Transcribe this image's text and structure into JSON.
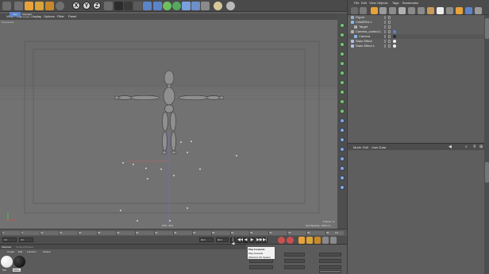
{
  "toolbar": {
    "letters": [
      "X",
      "Y",
      "Z"
    ],
    "icons": [
      "undo-icon",
      "selection-icon",
      "move-icon",
      "scale-icon",
      "rotate-icon",
      "render-view-icon",
      "render-settings-icon",
      "cube-icon",
      "pen-icon",
      "subdivision-icon",
      "array-icon",
      "deformer-icon",
      "floor-icon",
      "camera-icon",
      "light-icon"
    ]
  },
  "right_panel": {
    "menu": [
      "File",
      "Edit",
      "View",
      "Objects",
      "Tags",
      "Bookmarks"
    ],
    "objects": [
      {
        "name": "Figure",
        "indent": 0,
        "color": "#9ab0d0"
      },
      {
        "name": "CAMERA.1",
        "indent": 0,
        "color": "#8ab8e8"
      },
      {
        "name": "Target",
        "indent": 1,
        "color": "#b0b0b0"
      },
      {
        "name": "Camera_control.1",
        "indent": 0,
        "color": "#b0b0b0"
      },
      {
        "name": "Camera",
        "indent": 1,
        "color": "#8ab8e8"
      },
      {
        "name": "Stam Effect",
        "indent": 0,
        "color": "#b0c0e0"
      },
      {
        "name": "Stam Effect.1",
        "indent": 0,
        "color": "#b0c0e0"
      }
    ],
    "attr_menu": [
      "Mode",
      "Edit",
      "User Data"
    ]
  },
  "viewport": {
    "tabs": [
      "Start",
      "Standard"
    ],
    "menu": [
      "View",
      "Cameras",
      "Display",
      "Options",
      "Filter",
      "Panel"
    ],
    "label": "Perspective",
    "fps": "FPS : 25.6",
    "frames": "Frames : 0",
    "grid_spacing": "Grid Spacing : 1000 cm"
  },
  "timeline": {
    "ticks": [
      "0",
      "5",
      "10",
      "15",
      "20",
      "25",
      "30",
      "35",
      "40",
      "45",
      "50",
      "55",
      "60",
      "65",
      "70",
      "75",
      "80",
      "85",
      "90"
    ],
    "end_label": "0 F"
  },
  "transport": {
    "start": "0 F",
    "current": "0 F",
    "end": "90 F",
    "end2": "90 F",
    "buttons": [
      "|◀",
      "◀◀",
      "◀",
      "▶",
      "▶▶",
      "▶|"
    ]
  },
  "materials": {
    "tabs": [
      "Materials",
      "Content Browser"
    ],
    "menu": [
      "Create",
      "Edit",
      "Function",
      "Texture"
    ],
    "swatches": [
      {
        "name": "Mat",
        "color": "#ffffff"
      },
      {
        "name": "Matte",
        "color": "#101010"
      }
    ]
  },
  "tooltip": {
    "title": "Play Forwards",
    "line2": "Play forwards",
    "line3": "(Shortcut F8, Space)"
  },
  "colors": {
    "accent": "#e8a23a",
    "selection": "#5c84c9",
    "figure": "#8e8e8e"
  }
}
